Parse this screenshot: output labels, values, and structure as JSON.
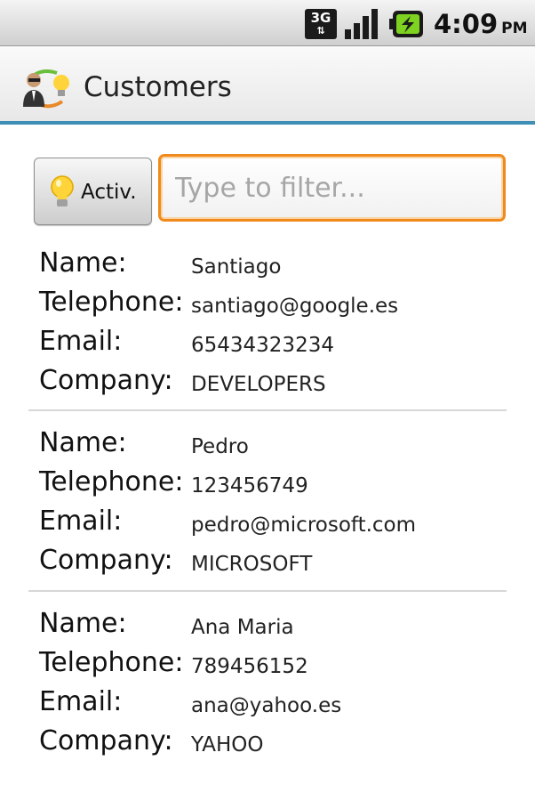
{
  "status_bar": {
    "network": "3G",
    "time": "4:09",
    "ampm": "PM",
    "icons": [
      "3g-network-icon",
      "signal-strength-icon",
      "battery-charging-icon"
    ]
  },
  "app": {
    "title": "Customers",
    "icon": "customers-app-icon"
  },
  "toolbar": {
    "activ_label": "Activ.",
    "activ_icon": "lightbulb-icon",
    "filter_placeholder": "Type to filter...",
    "filter_value": ""
  },
  "field_labels": {
    "name": "Name:",
    "telephone": "Telephone:",
    "email": "Email:",
    "company": "Company:"
  },
  "customers": [
    {
      "name": "Santiago",
      "telephone": "santiago@google.es",
      "email": "65434323234",
      "company": "DEVELOPERS"
    },
    {
      "name": "Pedro",
      "telephone": "123456749",
      "email": "pedro@microsoft.com",
      "company": "MICROSOFT"
    },
    {
      "name": "Ana Maria",
      "telephone": "789456152",
      "email": "ana@yahoo.es",
      "company": "YAHOO"
    }
  ],
  "colors": {
    "title_divider": "#3d8fb5",
    "filter_focus": "#f08a1c"
  }
}
